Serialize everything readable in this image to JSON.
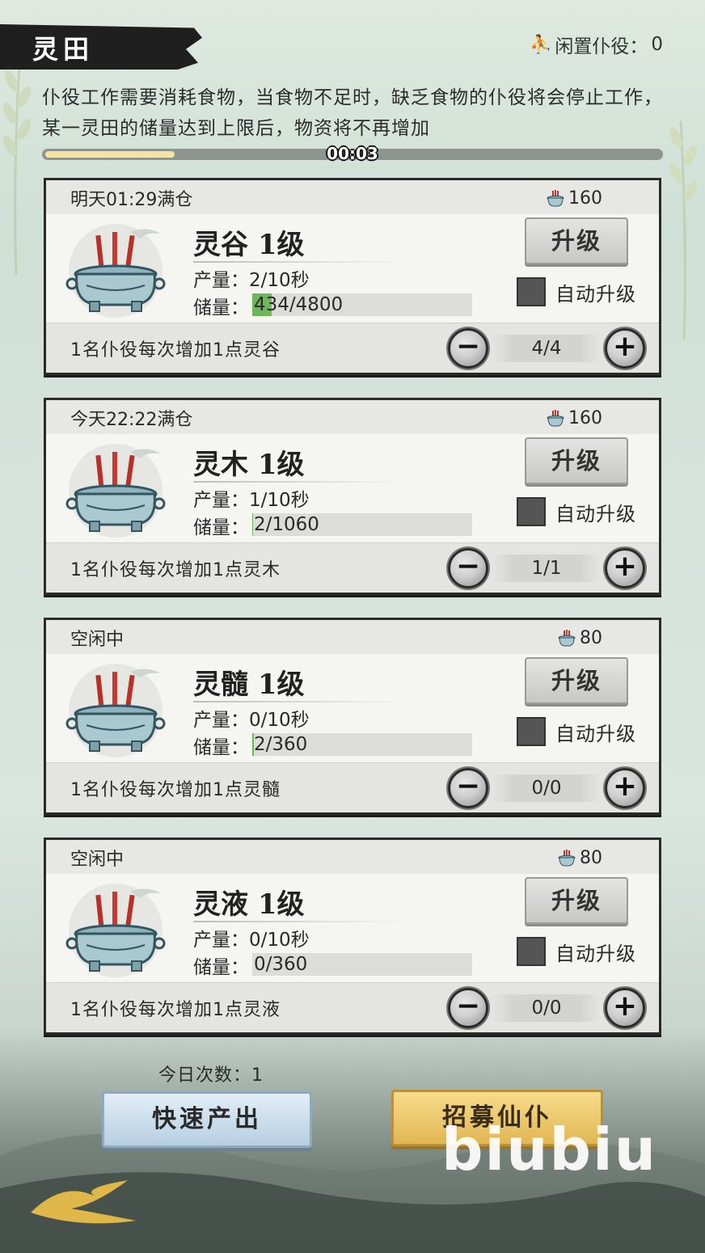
{
  "header": {
    "title": "灵田",
    "idle_label": "闲置仆役：",
    "idle_count": "0"
  },
  "description": "仆役工作需要消耗食物，当食物不足时，缺乏食物的仆役将会停止工作，某一灵田的储量达到上限后，物资将不再增加",
  "timer": {
    "text": "00:03",
    "progress": 0.21
  },
  "fields": [
    {
      "status": "明天01:29满仓",
      "cost": "160",
      "name": "灵谷 1级",
      "prod_label": "产量：",
      "prod": "2/10秒",
      "stor_label": "储量：",
      "stor": "434/4800",
      "stor_fill": 0.09,
      "upgrade": "升级",
      "auto": "自动升级",
      "hint": "1名仆役每次增加1点灵谷",
      "workers": "4/4"
    },
    {
      "status": "今天22:22满仓",
      "cost": "160",
      "name": "灵木 1级",
      "prod_label": "产量：",
      "prod": "1/10秒",
      "stor_label": "储量：",
      "stor": "2/1060",
      "stor_fill": 0.002,
      "upgrade": "升级",
      "auto": "自动升级",
      "hint": "1名仆役每次增加1点灵木",
      "workers": "1/1"
    },
    {
      "status": "空闲中",
      "cost": "80",
      "name": "灵髓 1级",
      "prod_label": "产量：",
      "prod": "0/10秒",
      "stor_label": "储量：",
      "stor": "2/360",
      "stor_fill": 0.006,
      "upgrade": "升级",
      "auto": "自动升级",
      "hint": "1名仆役每次增加1点灵髓",
      "workers": "0/0"
    },
    {
      "status": "空闲中",
      "cost": "80",
      "name": "灵液 1级",
      "prod_label": "产量：",
      "prod": "0/10秒",
      "stor_label": "储量：",
      "stor": "0/360",
      "stor_fill": 0,
      "upgrade": "升级",
      "auto": "自动升级",
      "hint": "1名仆役每次增加1点灵液",
      "workers": "0/0"
    }
  ],
  "stepper": {
    "minus": "−",
    "plus": "+"
  },
  "footer": {
    "today_count": "今日次数：1",
    "quick_btn": "快速产出",
    "recruit_btn": "招募仙仆"
  },
  "watermark": "biubiu",
  "colors": {
    "accent_green": "#6fb55c",
    "gold": "#e2b653",
    "blue": "#b7cfe2"
  }
}
